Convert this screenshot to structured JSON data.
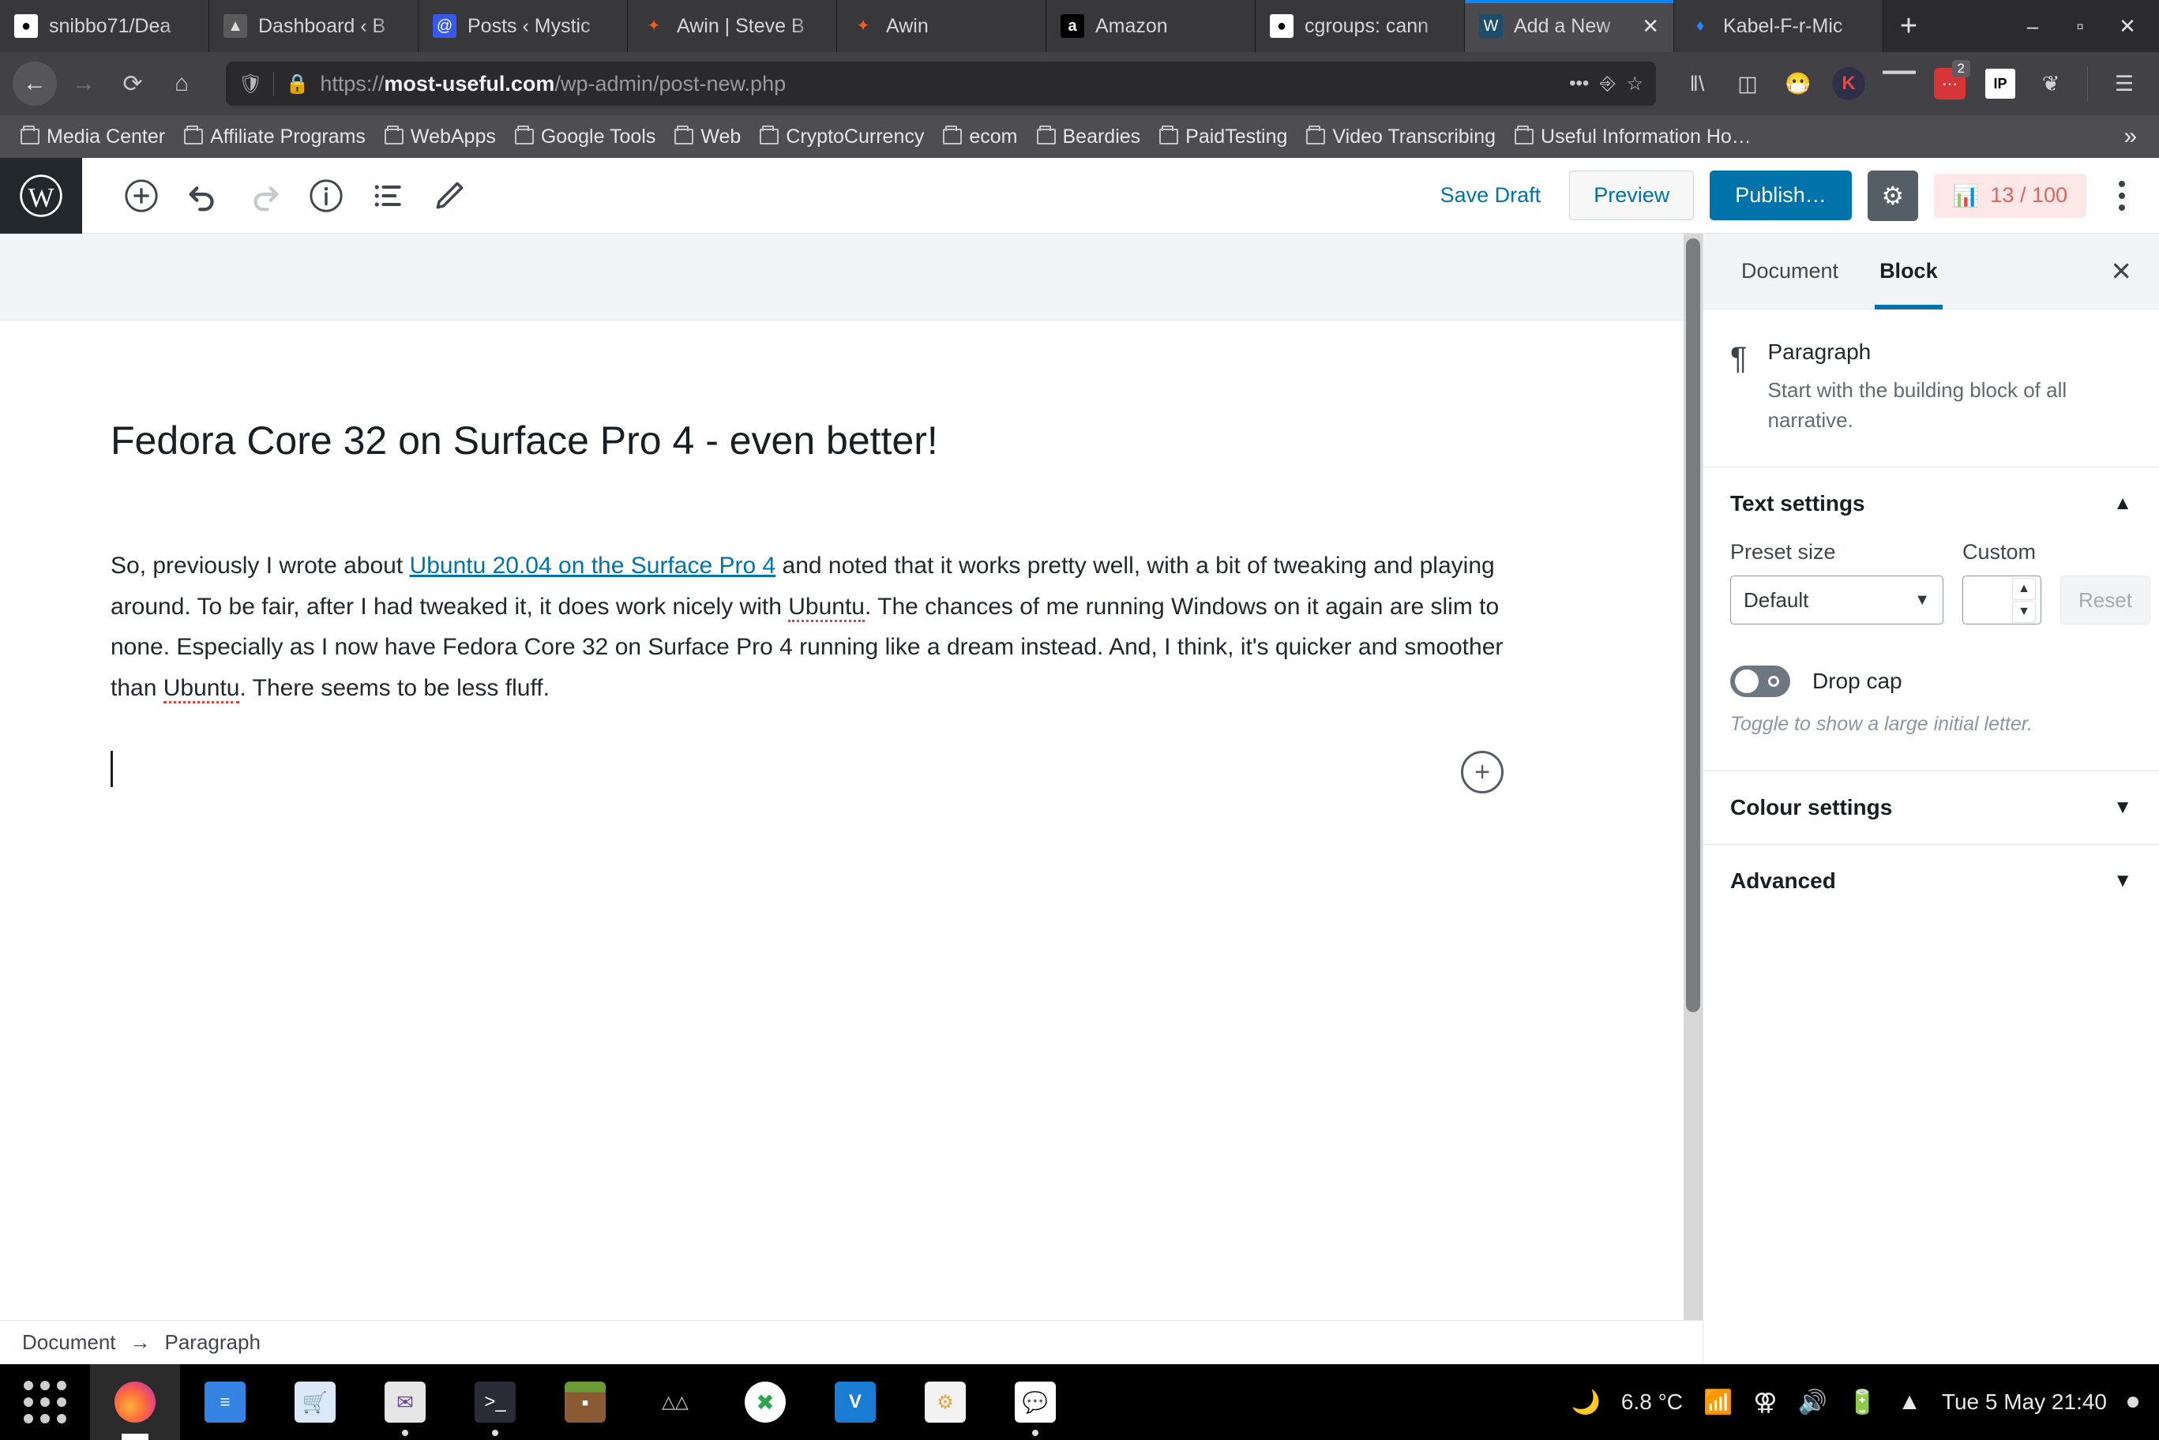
{
  "browser": {
    "tabs": [
      {
        "title": "snibbo71/Dea",
        "icon": "github-icon",
        "active": false
      },
      {
        "title": "Dashboard ‹ B",
        "icon": "dashboard-icon",
        "active": false
      },
      {
        "title": "Posts ‹ Mystic",
        "icon": "wordpress-posts-icon",
        "active": false
      },
      {
        "title": "Awin | Steve B",
        "icon": "awin-icon",
        "active": false
      },
      {
        "title": "Awin",
        "icon": "awin-icon",
        "active": false
      },
      {
        "title": "Amazon",
        "icon": "amazon-icon",
        "active": false
      },
      {
        "title": "cgroups: cann",
        "icon": "github-icon",
        "active": false
      },
      {
        "title": "Add a New",
        "icon": "wordpress-icon",
        "active": true
      },
      {
        "title": "Kabel-F-r-Mic",
        "icon": "kabel-icon",
        "active": false
      }
    ],
    "new_tab_label": "+",
    "window_controls": {
      "minimize": "–",
      "maximize": "▫",
      "close": "✕"
    },
    "nav": {
      "back": "←",
      "forward": "→",
      "reload": "⟳",
      "home": "⌂"
    },
    "url": {
      "scheme": "https://",
      "domain": "most-useful.com",
      "path": "/wp-admin/post-new.php",
      "full": "https://most-useful.com/wp-admin/post-new.php"
    },
    "url_actions": {
      "page_actions": "•••",
      "pocket": "pocket-icon",
      "bookmark": "☆"
    },
    "toolbar_icons": [
      {
        "name": "library-icon",
        "glyph": "‖∖"
      },
      {
        "name": "sidebar-icon",
        "glyph": "◫"
      },
      {
        "name": "smiley-mask-icon",
        "glyph": "😷"
      },
      {
        "name": "kaspersky-icon",
        "glyph": "K"
      },
      {
        "name": "fence-icon",
        "glyph": "⦀"
      },
      {
        "name": "adblock-icon",
        "glyph": "•••",
        "badge": "2"
      },
      {
        "name": "ip-icon",
        "glyph": "IP"
      },
      {
        "name": "gnome-icon",
        "glyph": "❦"
      },
      {
        "name": "hamburger-menu-icon",
        "glyph": "☰"
      }
    ],
    "bookmarks": [
      "Media Center",
      "Affiliate Programs",
      "WebApps",
      "Google Tools",
      "Web",
      "CryptoCurrency",
      "ecom",
      "Beardies",
      "PaidTesting",
      "Video Transcribing",
      "Useful Information Ho…"
    ],
    "bookmarks_overflow": "»"
  },
  "editor": {
    "toolbar": {
      "add_block": "add-block-icon",
      "undo": "undo-icon",
      "redo": "redo-icon",
      "info": "info-icon",
      "block_navigation": "block-navigation-icon",
      "edit_mode": "edit-pencil-icon",
      "save_draft_label": "Save Draft",
      "preview_label": "Preview",
      "publish_label": "Publish…",
      "settings_gear": "gear-icon",
      "seo_score": "13 / 100",
      "more_menu": "more-options-icon"
    },
    "post": {
      "title": "Fedora Core 32 on Surface Pro 4 - even better!",
      "paragraph": {
        "part1": "So, previously I wrote about ",
        "link": "Ubuntu 20.04 on the Surface Pro 4",
        "part2": " and noted that it works pretty well, with a bit of tweaking and playing around. To be fair, after I had tweaked it, it does work nicely with ",
        "spell1": "Ubuntu",
        "part3": ". The chances of me running Windows on it again are slim to none. Especially as I now have Fedora Core 32 on Surface Pro 4 running like a dream instead. And, I think, it's quicker and smoother than ",
        "spell2": "Ubuntu",
        "part4": ". There seems to be less fluff."
      },
      "inserter_label": "+"
    },
    "breadcrumb": {
      "document": "Document",
      "separator": "→",
      "current": "Paragraph"
    }
  },
  "sidebar": {
    "tabs": [
      {
        "label": "Document",
        "active": false
      },
      {
        "label": "Block",
        "active": true
      }
    ],
    "close_label": "✕",
    "block": {
      "icon_glyph": "¶",
      "name": "Paragraph",
      "description": "Start with the building block of all narrative."
    },
    "panels": [
      {
        "title": "Text settings",
        "expanded": true
      },
      {
        "title": "Colour settings",
        "expanded": false
      },
      {
        "title": "Advanced",
        "expanded": false
      }
    ],
    "text_settings": {
      "preset_size_label": "Preset size",
      "preset_size_value": "Default",
      "custom_label": "Custom",
      "custom_value": "",
      "reset_label": "Reset",
      "dropcap_label": "Drop cap",
      "dropcap_enabled": false,
      "dropcap_hint": "Toggle to show a large initial letter."
    }
  },
  "taskbar": {
    "apps_grid": "apps-grid-icon",
    "items": [
      {
        "name": "firefox",
        "label": "Firefox",
        "active": true
      },
      {
        "name": "files",
        "label": "Files",
        "active": false
      },
      {
        "name": "software",
        "label": "Software",
        "active": false
      },
      {
        "name": "mail",
        "label": "Mail",
        "active": false
      },
      {
        "name": "terminal",
        "label": "Terminal",
        "active": false
      },
      {
        "name": "minecraft",
        "label": "Minecraft",
        "active": false
      },
      {
        "name": "virt-manager",
        "label": "Virtual Machine Manager",
        "active": false
      },
      {
        "name": "x2go",
        "label": "X2Go",
        "active": false
      },
      {
        "name": "vnc",
        "label": "VNC Viewer",
        "active": false
      },
      {
        "name": "system-monitor",
        "label": "System Monitor",
        "active": false
      },
      {
        "name": "chat",
        "label": "Chat",
        "active": false
      }
    ],
    "tray": {
      "weather_icon": "weather-cloudy-night-icon",
      "temperature": "6.8 °C",
      "wifi_icon": "wifi-icon",
      "bluetooth_icon": "bluetooth-icon",
      "volume_icon": "volume-icon",
      "battery_icon": "battery-charging-icon",
      "expand_icon": "▲",
      "clock": "Tue 5 May  21:40",
      "menu_dot": "●"
    }
  },
  "colors": {
    "wp_blue": "#0073aa",
    "chrome_dark": "#323234",
    "tab_active": "#4b4b4f",
    "accent_tab_bar": "#0a84ff",
    "seo_red": "#e2645f",
    "seo_bg": "#fde7e7"
  }
}
